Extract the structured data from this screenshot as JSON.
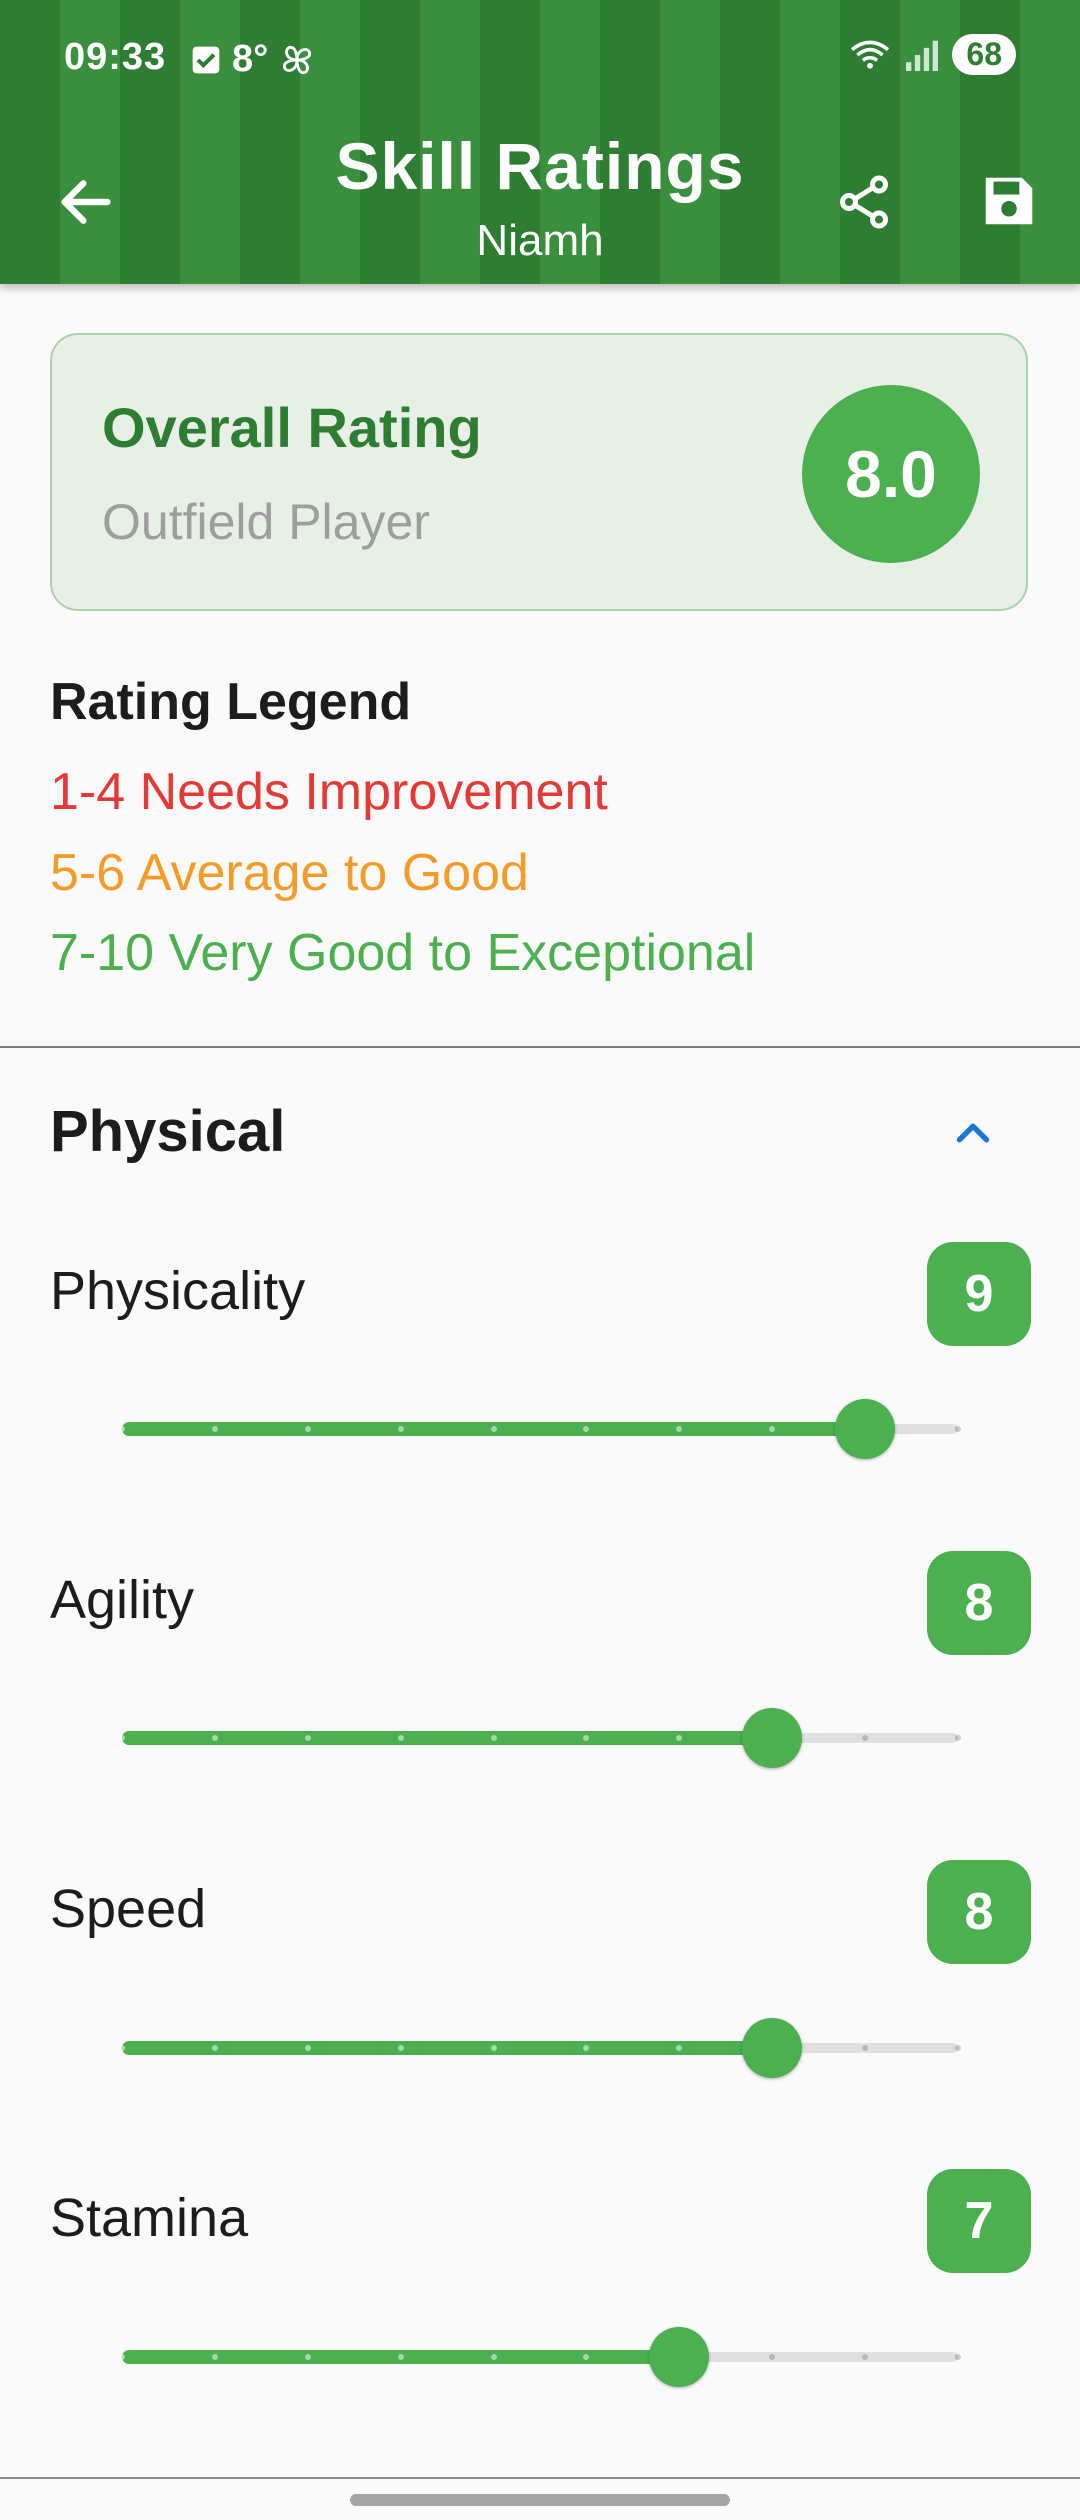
{
  "status_bar": {
    "time": "09:33",
    "temperature": "8°",
    "battery": "68"
  },
  "header": {
    "title": "Skill Ratings",
    "subtitle": "Niamh"
  },
  "overall": {
    "label": "Overall Rating",
    "subtitle": "Outfield Player",
    "value": "8.0"
  },
  "legend": {
    "title": "Rating Legend",
    "items": [
      {
        "text": "1-4 Needs Improvement",
        "color": "#e53935"
      },
      {
        "text": "5-6 Average to Good",
        "color": "#f39c2a"
      },
      {
        "text": "7-10 Very Good to Exceptional",
        "color": "#4caf50"
      }
    ]
  },
  "section": {
    "title": "Physical"
  },
  "skills": [
    {
      "name": "Physicality",
      "value": 9
    },
    {
      "name": "Agility",
      "value": 8
    },
    {
      "name": "Speed",
      "value": 8
    },
    {
      "name": "Stamina",
      "value": 7
    }
  ],
  "colors": {
    "accent": "#4caf50",
    "header_green": "#2e7d32"
  }
}
